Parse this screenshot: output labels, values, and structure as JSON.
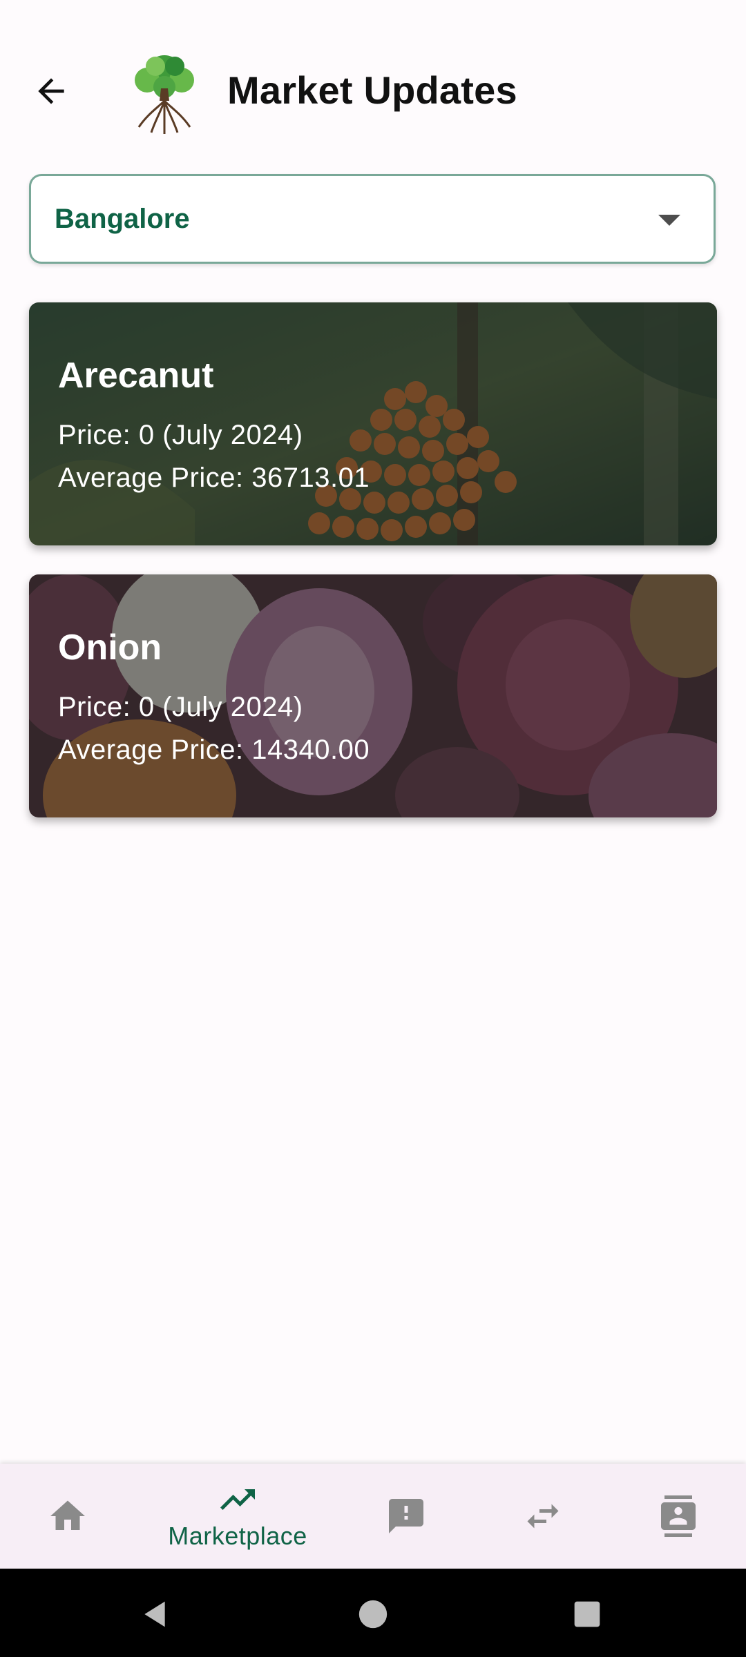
{
  "header": {
    "title": "Market Updates"
  },
  "location_select": {
    "value": "Bangalore"
  },
  "cards": [
    {
      "name": "Arecanut",
      "price": "Price: 0 (July 2024)",
      "average": "Average Price: 36713.01"
    },
    {
      "name": "Onion",
      "price": "Price: 0 (July 2024)",
      "average": "Average Price: 14340.00"
    }
  ],
  "bottom_nav": {
    "items": [
      {
        "icon": "home-icon",
        "label": ""
      },
      {
        "icon": "trending-up-icon",
        "label": "Marketplace"
      },
      {
        "icon": "feedback-icon",
        "label": ""
      },
      {
        "icon": "swap-icon",
        "label": ""
      },
      {
        "icon": "contacts-icon",
        "label": ""
      }
    ],
    "active_color": "#0f6346",
    "inactive_color": "#8a8a8a"
  }
}
